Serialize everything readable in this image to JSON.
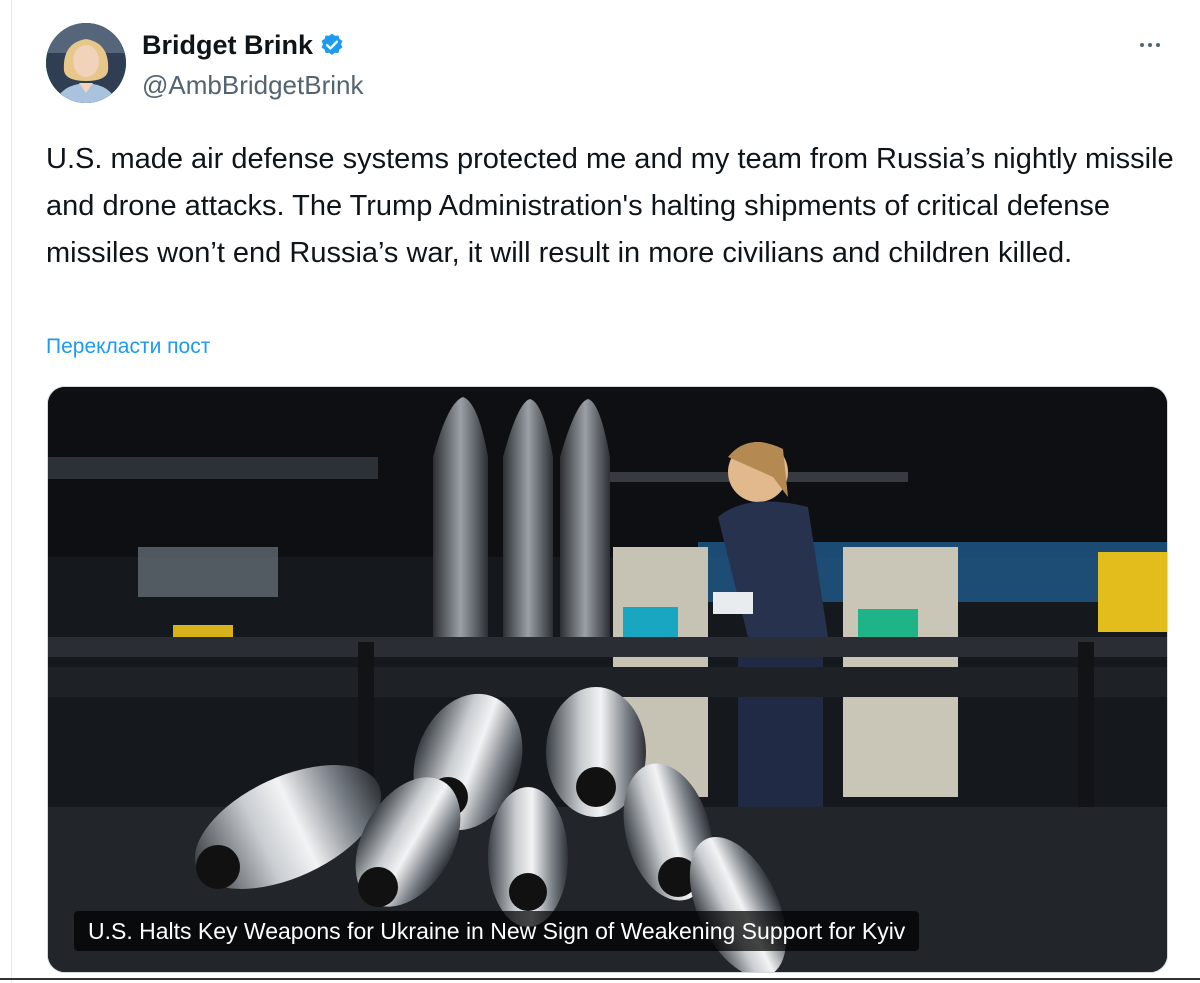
{
  "author": {
    "name": "Bridget Brink",
    "handle": "@AmbBridgetBrink",
    "verified_icon": "verified-badge-icon",
    "avatar": "profile-photo"
  },
  "menu": {
    "icon": "more-options-icon"
  },
  "tweet": {
    "text": "U.S. made air defense systems protected me and my team from Russia’s nightly missile and drone attacks. The Trump Administration's halting shipments of critical defense missiles won’t end Russia’s war, it will result in more civilians and children killed.",
    "translate_label": "Перекласти пост"
  },
  "card": {
    "headline": "U.S. Halts Key Weapons for Ukraine in New Sign of Weakening Support for Kyiv",
    "image": "factory-artillery-shells-photo"
  },
  "colors": {
    "link": "#1d9bf0",
    "verified": "#1d9bf0",
    "text": "#0f1419",
    "secondary": "#536471"
  }
}
